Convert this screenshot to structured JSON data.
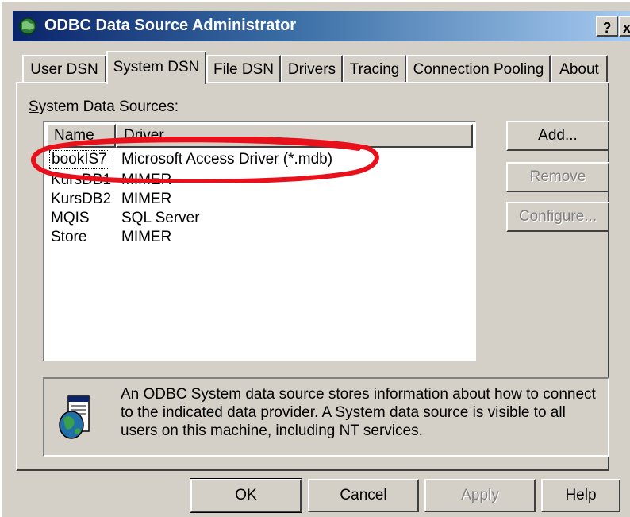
{
  "window": {
    "title": "ODBC Data Source Administrator",
    "help_button": "?",
    "close_button": "x"
  },
  "tabs": [
    {
      "label": "User DSN",
      "active": false
    },
    {
      "label": "System DSN",
      "active": true
    },
    {
      "label": "File DSN",
      "active": false
    },
    {
      "label": "Drivers",
      "active": false
    },
    {
      "label": "Tracing",
      "active": false
    },
    {
      "label": "Connection Pooling",
      "active": false
    },
    {
      "label": "About",
      "active": false
    }
  ],
  "section": {
    "label_mnemonic": "S",
    "label_rest": "ystem Data Sources:"
  },
  "list": {
    "columns": [
      "Name",
      "Driver"
    ],
    "rows": [
      {
        "name": "bookIS7",
        "driver": "Microsoft Access Driver (*.mdb)",
        "selected": true
      },
      {
        "name": "KursDB1",
        "driver": "MIMER"
      },
      {
        "name": "KursDB2",
        "driver": "MIMER"
      },
      {
        "name": "MQIS",
        "driver": "SQL Server"
      },
      {
        "name": "Store",
        "driver": "MIMER"
      }
    ]
  },
  "side_buttons": {
    "add": "Add...",
    "remove": "Remove",
    "configure": "Configure..."
  },
  "info": {
    "text": "An ODBC System data source stores information about how to connect to the indicated data provider.  A System data source is visible to all users on this machine, including NT services."
  },
  "bottom_buttons": {
    "ok": "OK",
    "cancel": "Cancel",
    "apply": "Apply",
    "help": "Help"
  },
  "colors": {
    "title_gradient_start": "#0a246a",
    "title_gradient_end": "#a6caf0",
    "annotation_ellipse": "#e8101a",
    "dialog_face": "#d4d0c8"
  },
  "icons": {
    "app": "odbc-globe-icon",
    "info": "database-globe-icon"
  }
}
